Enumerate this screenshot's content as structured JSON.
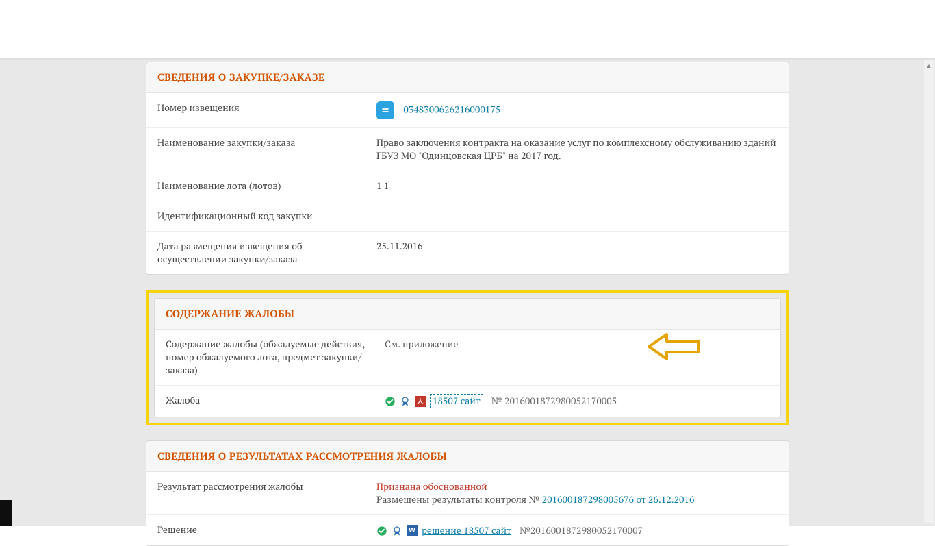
{
  "section1": {
    "title": "СВЕДЕНИЯ О ЗАКУПКЕ/ЗАКАЗЕ",
    "rows": {
      "notice_label": "Номер извещения",
      "notice_link": "0348300626216000175",
      "name_label": "Наименование закупки/заказа",
      "name_value": "Право заключения контракта на оказание услуг по комплексному обслуживанию зданий ГБУЗ МО \"Одинцовская ЦРБ\" на 2017 год.",
      "lot_label": "Наименование лота (лотов)",
      "lot_value": "1 1",
      "id_label": "Идентификационный код закупки",
      "id_value": "",
      "date_label": "Дата размещения извещения об осуществлении закупки/заказа",
      "date_value": "25.11.2016"
    }
  },
  "section2": {
    "title": "СОДЕРЖАНИЕ ЖАЛОБЫ",
    "rows": {
      "content_label": "Содержание жалобы (обжалуемые действия, номер обжалуемого лота, предмет закупки/заказа)",
      "content_value": "См. приложение",
      "complaint_label": "Жалоба",
      "complaint_file": "18507 сайт",
      "complaint_number": "№ 2016001872980052170005"
    }
  },
  "section3": {
    "title": "СВЕДЕНИЯ О РЕЗУЛЬТАТАХ РАССМОТРЕНИЯ ЖАЛОБЫ",
    "rows": {
      "result_label": "Результат рассмотрения жалобы",
      "result_value": "Признана обоснованной",
      "result_sub_prefix": "Размещены результаты контроля № ",
      "result_sub_link": "201600187298005676 от 26.12.2016",
      "decision_label": "Решение",
      "decision_file": "решение 18507 сайт",
      "decision_number": "№2016001872980052170007"
    }
  },
  "icons": {
    "pdf_glyph": "人",
    "word_glyph": "W"
  }
}
